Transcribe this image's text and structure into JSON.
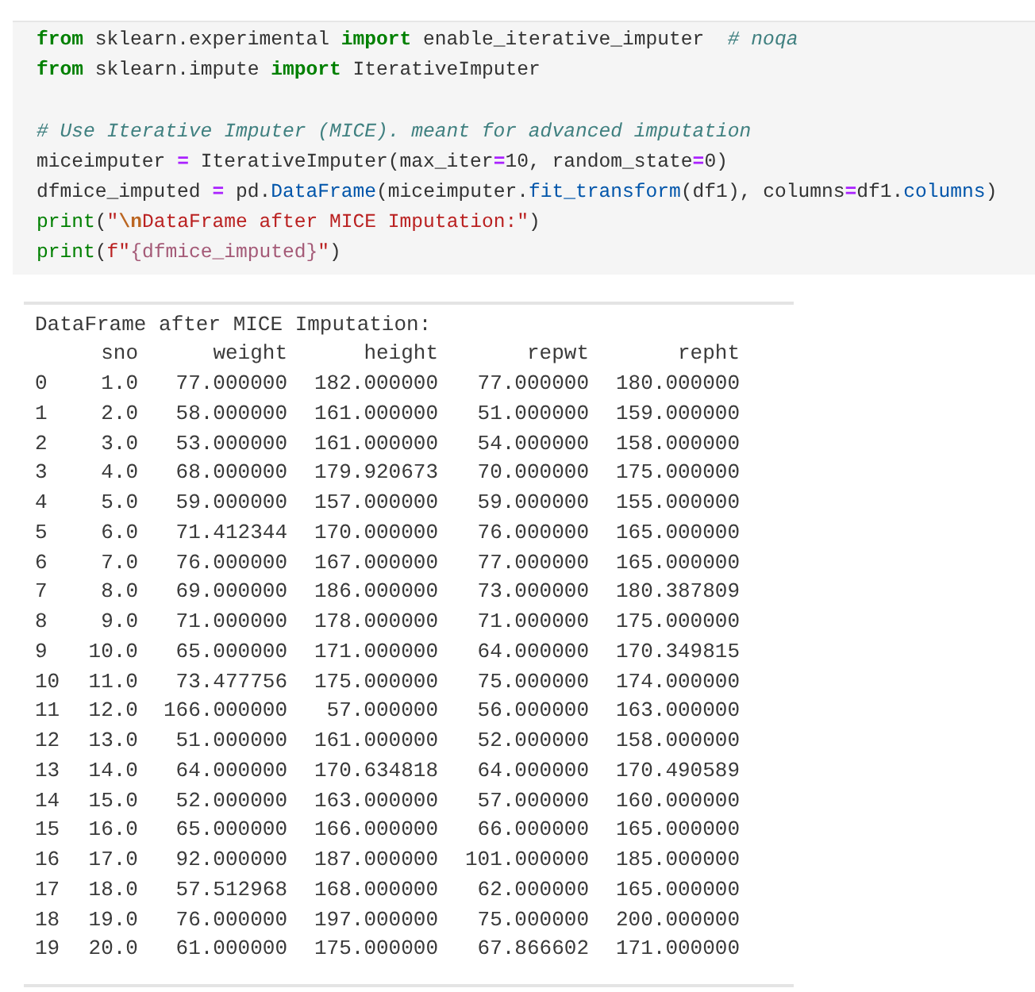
{
  "code_cell": {
    "lines": [
      {
        "kind": "code",
        "tokens": [
          {
            "kind": "kw",
            "text": "from"
          },
          {
            "kind": "plain",
            "text": " sklearn.experimental "
          },
          {
            "kind": "kw",
            "text": "import"
          },
          {
            "kind": "plain",
            "text": " enable_iterative_imputer  "
          },
          {
            "kind": "comment",
            "text": "# noqa"
          }
        ]
      },
      {
        "kind": "code",
        "tokens": [
          {
            "kind": "kw",
            "text": "from"
          },
          {
            "kind": "plain",
            "text": " sklearn.impute "
          },
          {
            "kind": "kw",
            "text": "import"
          },
          {
            "kind": "plain",
            "text": " IterativeImputer"
          }
        ]
      },
      {
        "kind": "blank"
      },
      {
        "kind": "code",
        "tokens": [
          {
            "kind": "comment",
            "text": "# Use Iterative Imputer (MICE). meant for advanced imputation"
          }
        ]
      },
      {
        "kind": "code",
        "tokens": [
          {
            "kind": "plain",
            "text": "miceimputer "
          },
          {
            "kind": "op",
            "text": "="
          },
          {
            "kind": "plain",
            "text": " IterativeImputer(max_iter"
          },
          {
            "kind": "op",
            "text": "="
          },
          {
            "kind": "plain",
            "text": "10, random_state"
          },
          {
            "kind": "op",
            "text": "="
          },
          {
            "kind": "plain",
            "text": "0)"
          }
        ]
      },
      {
        "kind": "code",
        "tokens": [
          {
            "kind": "plain",
            "text": "dfmice_imputed "
          },
          {
            "kind": "op",
            "text": "="
          },
          {
            "kind": "plain",
            "text": " pd."
          },
          {
            "kind": "attr",
            "text": "DataFrame"
          },
          {
            "kind": "plain",
            "text": "(miceimputer."
          },
          {
            "kind": "attr",
            "text": "fit_transform"
          },
          {
            "kind": "plain",
            "text": "(df1), columns"
          },
          {
            "kind": "op",
            "text": "="
          },
          {
            "kind": "plain",
            "text": "df1."
          },
          {
            "kind": "attr",
            "text": "columns"
          },
          {
            "kind": "plain",
            "text": ")"
          }
        ]
      },
      {
        "kind": "code",
        "tokens": [
          {
            "kind": "builtin",
            "text": "print"
          },
          {
            "kind": "plain",
            "text": "("
          },
          {
            "kind": "string",
            "text": "\""
          },
          {
            "kind": "escape",
            "text": "\\n"
          },
          {
            "kind": "string",
            "text": "DataFrame after MICE Imputation:\""
          },
          {
            "kind": "plain",
            "text": ")"
          }
        ]
      },
      {
        "kind": "code",
        "tokens": [
          {
            "kind": "builtin",
            "text": "print"
          },
          {
            "kind": "plain",
            "text": "("
          },
          {
            "kind": "string",
            "text": "f\""
          },
          {
            "kind": "interp",
            "text": "{dfmice_imputed}"
          },
          {
            "kind": "string",
            "text": "\""
          },
          {
            "kind": "plain",
            "text": ")"
          }
        ]
      }
    ]
  },
  "output": {
    "title": "DataFrame after MICE Imputation:",
    "columns": [
      "sno",
      "weight",
      "height",
      "repwt",
      "repht"
    ],
    "rows": [
      {
        "index": "0",
        "values": [
          "1.0",
          "77.000000",
          "182.000000",
          "77.000000",
          "180.000000"
        ]
      },
      {
        "index": "1",
        "values": [
          "2.0",
          "58.000000",
          "161.000000",
          "51.000000",
          "159.000000"
        ]
      },
      {
        "index": "2",
        "values": [
          "3.0",
          "53.000000",
          "161.000000",
          "54.000000",
          "158.000000"
        ]
      },
      {
        "index": "3",
        "values": [
          "4.0",
          "68.000000",
          "179.920673",
          "70.000000",
          "175.000000"
        ]
      },
      {
        "index": "4",
        "values": [
          "5.0",
          "59.000000",
          "157.000000",
          "59.000000",
          "155.000000"
        ]
      },
      {
        "index": "5",
        "values": [
          "6.0",
          "71.412344",
          "170.000000",
          "76.000000",
          "165.000000"
        ]
      },
      {
        "index": "6",
        "values": [
          "7.0",
          "76.000000",
          "167.000000",
          "77.000000",
          "165.000000"
        ]
      },
      {
        "index": "7",
        "values": [
          "8.0",
          "69.000000",
          "186.000000",
          "73.000000",
          "180.387809"
        ]
      },
      {
        "index": "8",
        "values": [
          "9.0",
          "71.000000",
          "178.000000",
          "71.000000",
          "175.000000"
        ]
      },
      {
        "index": "9",
        "values": [
          "10.0",
          "65.000000",
          "171.000000",
          "64.000000",
          "170.349815"
        ]
      },
      {
        "index": "10",
        "values": [
          "11.0",
          "73.477756",
          "175.000000",
          "75.000000",
          "174.000000"
        ]
      },
      {
        "index": "11",
        "values": [
          "12.0",
          "166.000000",
          "57.000000",
          "56.000000",
          "163.000000"
        ]
      },
      {
        "index": "12",
        "values": [
          "13.0",
          "51.000000",
          "161.000000",
          "52.000000",
          "158.000000"
        ]
      },
      {
        "index": "13",
        "values": [
          "14.0",
          "64.000000",
          "170.634818",
          "64.000000",
          "170.490589"
        ]
      },
      {
        "index": "14",
        "values": [
          "15.0",
          "52.000000",
          "163.000000",
          "57.000000",
          "160.000000"
        ]
      },
      {
        "index": "15",
        "values": [
          "16.0",
          "65.000000",
          "166.000000",
          "66.000000",
          "165.000000"
        ]
      },
      {
        "index": "16",
        "values": [
          "17.0",
          "92.000000",
          "187.000000",
          "101.000000",
          "185.000000"
        ]
      },
      {
        "index": "17",
        "values": [
          "18.0",
          "57.512968",
          "168.000000",
          "62.000000",
          "165.000000"
        ]
      },
      {
        "index": "18",
        "values": [
          "19.0",
          "76.000000",
          "197.000000",
          "75.000000",
          "200.000000"
        ]
      },
      {
        "index": "19",
        "values": [
          "20.0",
          "61.000000",
          "175.000000",
          "67.866602",
          "171.000000"
        ]
      }
    ]
  }
}
